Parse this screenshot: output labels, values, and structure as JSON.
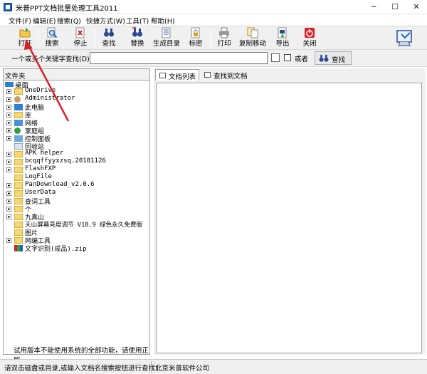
{
  "window": {
    "title": "米普PPT文档批量处理工具2011"
  },
  "menu": [
    "文件(F)",
    "编辑(E)",
    "搜索(Q)",
    "快捷方式(W)",
    "工具(T)",
    "帮助(H)"
  ],
  "toolbar": {
    "open": "打开",
    "search": "搜索",
    "stop": "停止",
    "find": "查找",
    "replace": "替换",
    "gen_dir": "生成目录",
    "password": "标密",
    "print": "打印",
    "copy_move": "复制移动",
    "export": "导出",
    "close": "关闭"
  },
  "searchbar": {
    "label": "一个或多个关键字查找(D)",
    "value": "",
    "or_label": "或者",
    "find_button": "查找"
  },
  "left_pane": {
    "header": "文件夹",
    "desktop": "桌面",
    "items": [
      "OneDrive",
      "Administrator",
      "此电脑",
      "库",
      "网络",
      "家庭组",
      "控制面板",
      "回收站",
      "APK helper",
      "bcqqffyyxzsq.20181126",
      "FlashFXP",
      "LogFile",
      "PanDownload_v2.0.6",
      "UserData",
      "查词工具",
      "个",
      "九真山",
      "天山屏幕亮度调节 V18.9 绿色永久免费版",
      "图片",
      "网编工具",
      "文字识别(成品).zip"
    ],
    "trial_message": "试用版本不能使用系统的全部功能，请使用正版"
  },
  "right_pane": {
    "tab_doc_list": "文档列表",
    "tab_find_doc": "查找到文档"
  },
  "status": {
    "left": "请双击磁盘或目录,或输入文档名搜索按钮进行查找!",
    "right": "北京米普软件公司"
  },
  "colors": {
    "accent": "#1f64b8",
    "folder": "#f8d775",
    "annotation": "#d9202a"
  }
}
